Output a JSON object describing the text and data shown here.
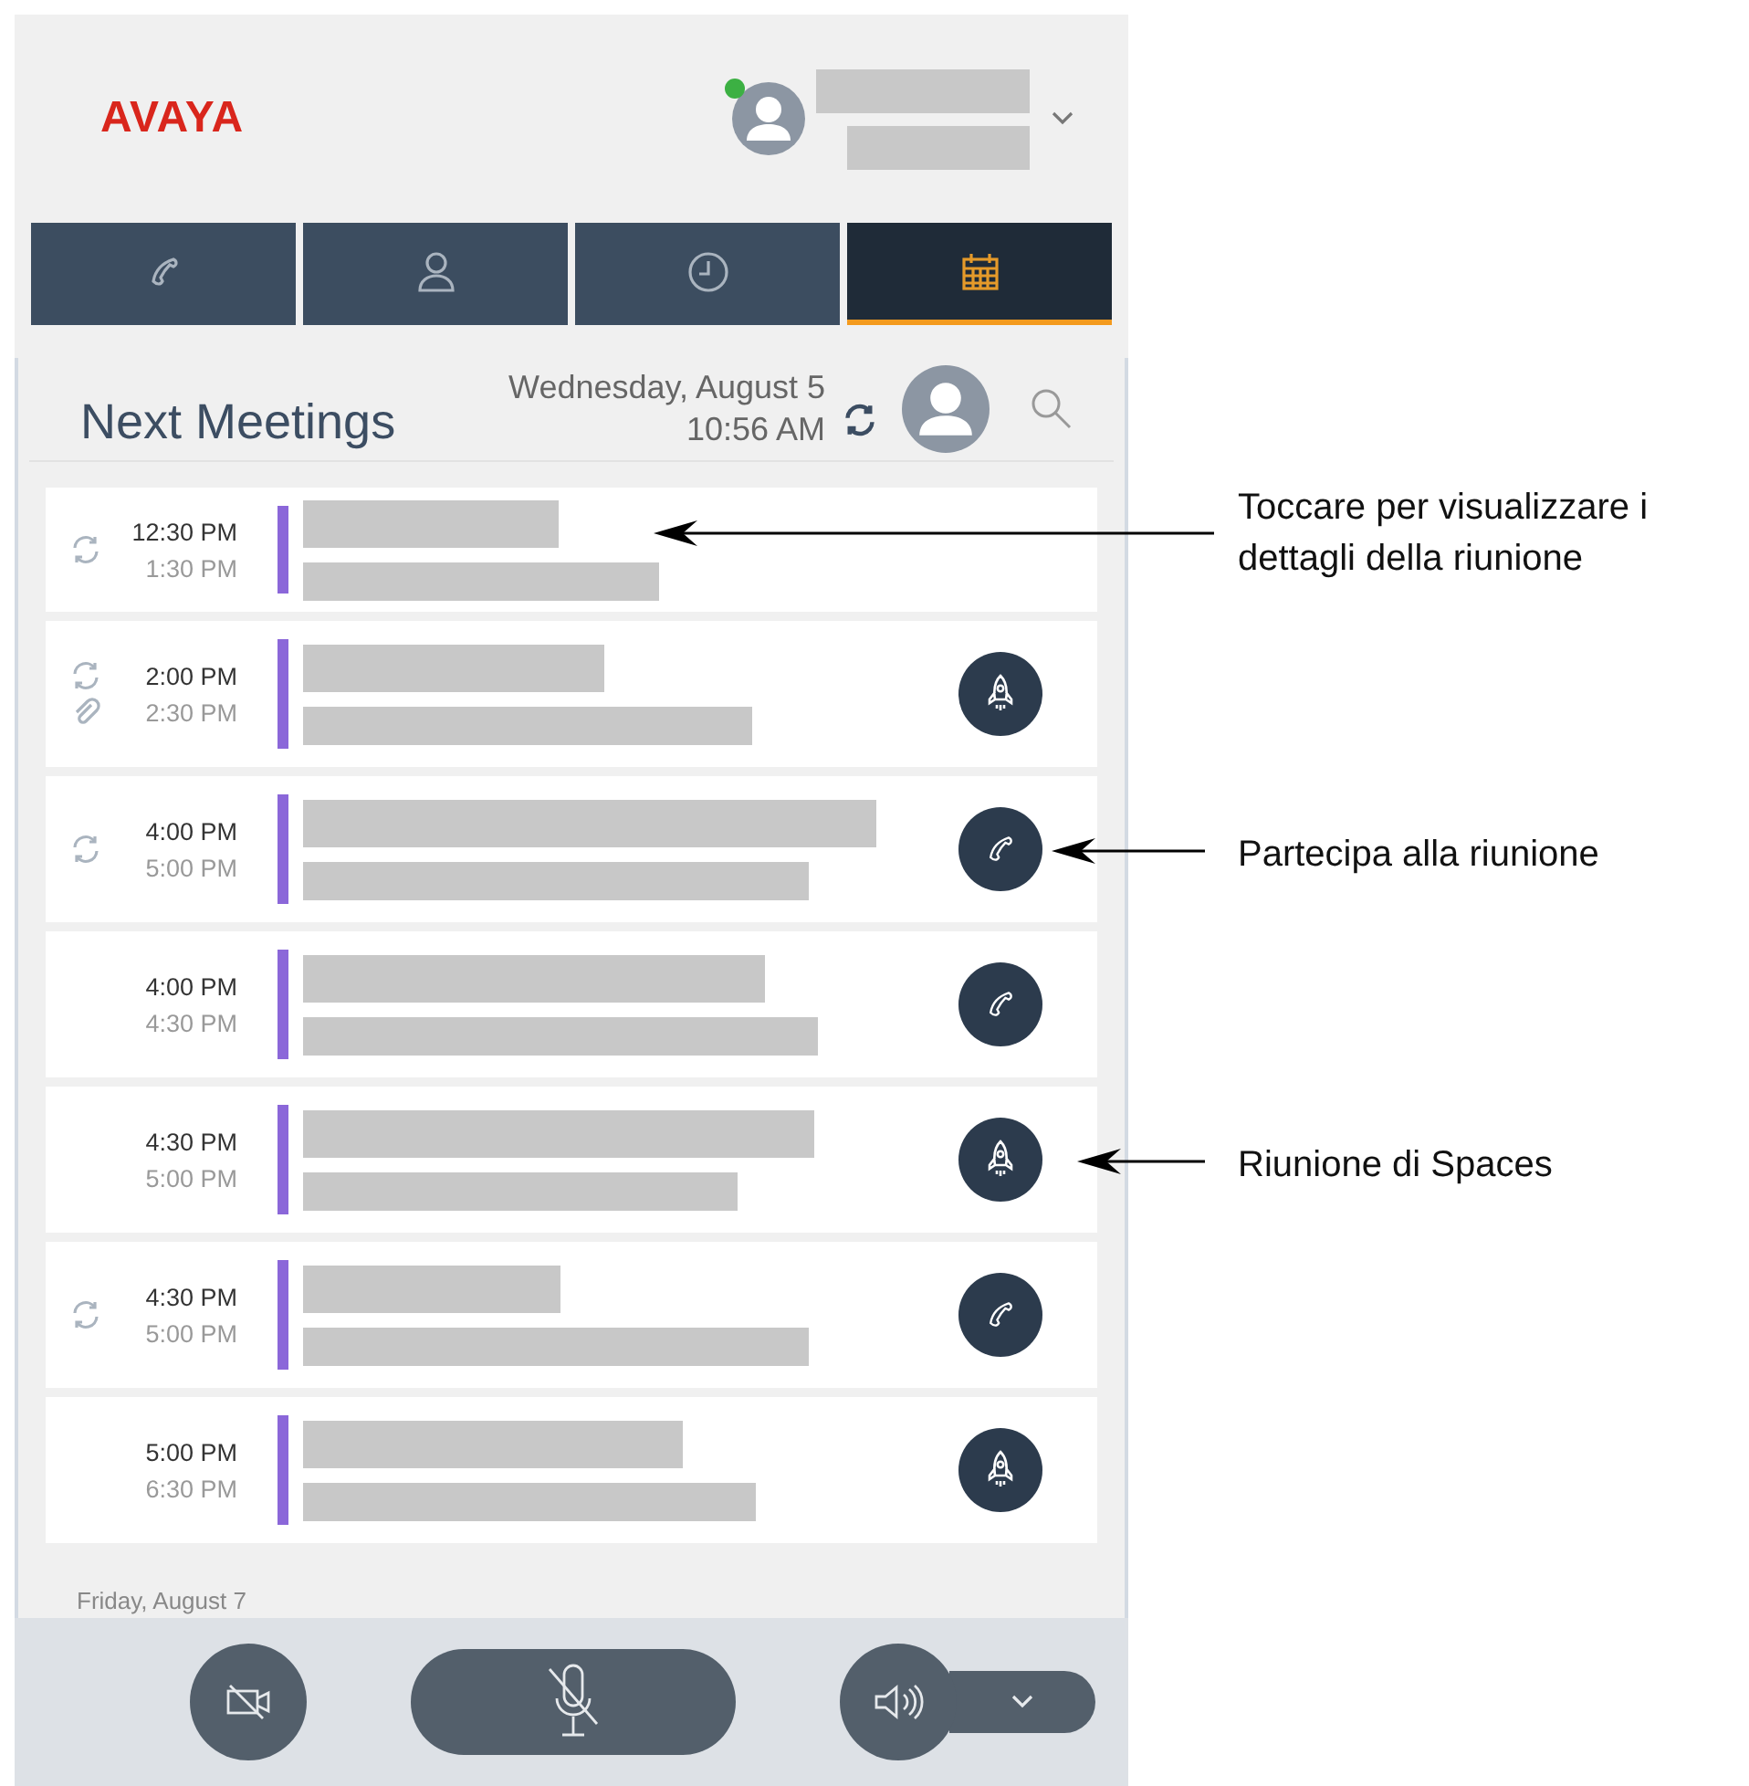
{
  "header": {
    "logo": "AVAYA",
    "presence": {
      "color": "#3cb043"
    }
  },
  "tabs": [
    {
      "kind": "phone",
      "selected": false
    },
    {
      "kind": "contact",
      "selected": false
    },
    {
      "kind": "history",
      "selected": false
    },
    {
      "kind": "calendar",
      "selected": true
    }
  ],
  "title": "Next Meetings",
  "date": "Wednesday, August 5",
  "time": "10:56 AM",
  "meetings": [
    {
      "start": "12:30 PM",
      "end": "1:30 PM",
      "recurring": true,
      "attachment": false,
      "kind": "plain"
    },
    {
      "start": "2:00 PM",
      "end": "2:30 PM",
      "recurring": true,
      "attachment": true,
      "kind": "spaces"
    },
    {
      "start": "4:00 PM",
      "end": "5:00 PM",
      "recurring": true,
      "attachment": false,
      "kind": "call"
    },
    {
      "start": "4:00 PM",
      "end": "4:30 PM",
      "recurring": false,
      "attachment": false,
      "kind": "call"
    },
    {
      "start": "4:30 PM",
      "end": "5:00 PM",
      "recurring": false,
      "attachment": false,
      "kind": "spaces"
    },
    {
      "start": "4:30 PM",
      "end": "5:00 PM",
      "recurring": true,
      "attachment": false,
      "kind": "call"
    },
    {
      "start": "5:00 PM",
      "end": "6:30 PM",
      "recurring": false,
      "attachment": false,
      "kind": "spaces"
    }
  ],
  "next_day": "Friday, August 7",
  "controls": {
    "video_muted": true,
    "mic_muted": true
  },
  "annotations": [
    {
      "text": "Toccare per visualizzare i dettagli della riunione"
    },
    {
      "text": "Partecipa alla riunione"
    },
    {
      "text": "Riunione di Spaces"
    }
  ]
}
